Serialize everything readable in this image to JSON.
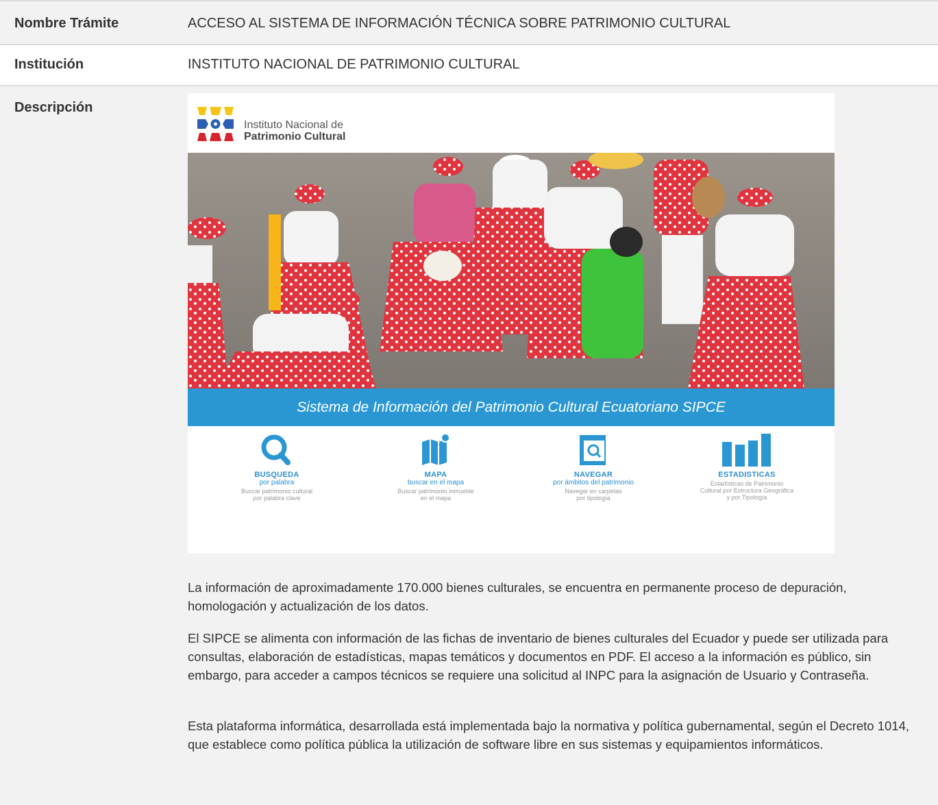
{
  "rows": {
    "tramite": {
      "label": "Nombre Trámite",
      "value": "ACCESO AL SISTEMA DE INFORMACIÓN TÉCNICA SOBRE PATRIMONIO CULTURAL"
    },
    "institucion": {
      "label": "Institución",
      "value": "INSTITUTO NACIONAL DE PATRIMONIO CULTURAL"
    },
    "descripcion": {
      "label": "Descripción"
    }
  },
  "banner": {
    "logo_line1": "Instituto Nacional de",
    "logo_line2": "Patrimonio Cultural",
    "title": "Sistema de Información del Patrimonio Cultural Ecuatoriano SIPCE",
    "features": [
      {
        "title": "BUSQUEDA",
        "subtitle": "por palabra",
        "desc": "Buscar patrimonio cultural\npor palabra clave",
        "icon": "search-icon"
      },
      {
        "title": "MAPA",
        "subtitle": "buscar en el mapa",
        "desc": "Buscar patrimonio inmueble\nen el mapa",
        "icon": "map-icon"
      },
      {
        "title": "NAVEGAR",
        "subtitle": "por ámbitos del patrimonio",
        "desc": "Navegar en carpetas\npor tipología",
        "icon": "folder-search-icon"
      },
      {
        "title": "ESTADISTICAS",
        "subtitle": "",
        "desc": "Estadísticas de Patrimonio\nCultural por Estructura Geográfica\ny por Tipología",
        "icon": "bar-chart-icon"
      }
    ],
    "colors": {
      "accent": "#2a97d3",
      "logo_yellow": "#f6c51b",
      "logo_blue": "#2a5fb3",
      "logo_red": "#d6242e"
    }
  },
  "paragraphs": [
    "La información de aproximadamente 170.000 bienes culturales, se encuentra en permanente proceso de depuración, homologación y actualización de los datos.",
    "El SIPCE se alimenta con información de las fichas de inventario de bienes culturales del Ecuador y puede ser utilizada para consultas, elaboración de estadísticas, mapas temáticos y documentos en PDF. El acceso a la información es público, sin embargo, para acceder a campos técnicos se requiere una solicitud al INPC para la asignación de Usuario y Contraseña.",
    "Esta plataforma informática, desarrollada está implementada bajo la normativa y política gubernamental, según el Decreto 1014, que establece como política pública la utilización de software libre en sus sistemas y equipamientos informáticos."
  ]
}
